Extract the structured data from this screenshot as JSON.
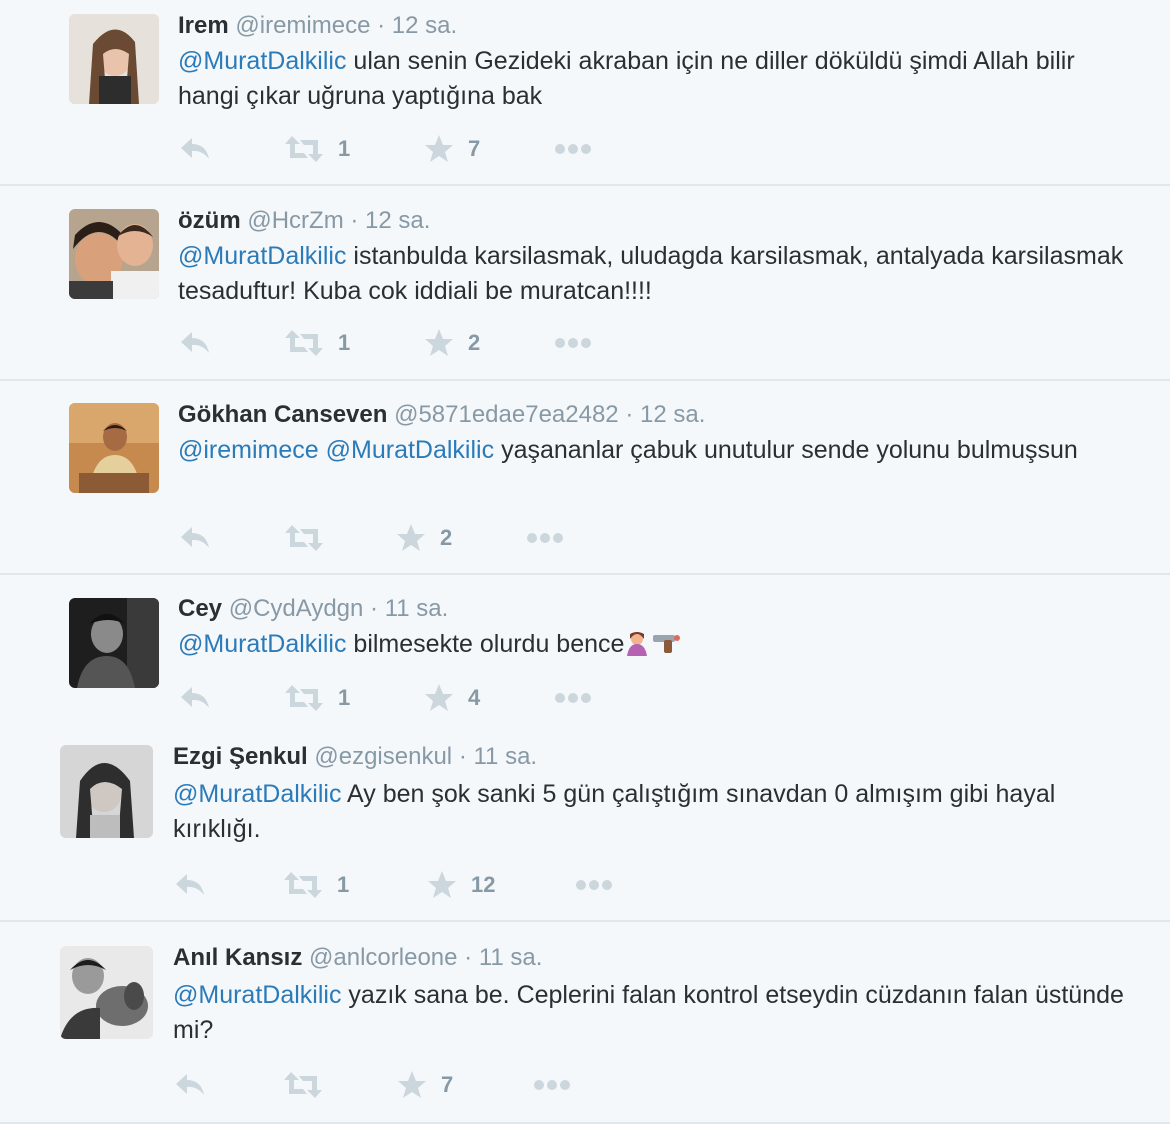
{
  "colors": {
    "mention": "#2b7bb9",
    "meta": "#8899a6",
    "text": "#292f33",
    "background": "#f5f8fa",
    "divider": "#e1e8ed"
  },
  "icons": {
    "reply": "reply-icon",
    "retweet": "retweet-icon",
    "favorite": "star-icon",
    "more": "more-icon"
  },
  "tweets": [
    {
      "name": "Irem",
      "handle": "@iremimece",
      "dot": "·",
      "time": "12 sa.",
      "mentions": [
        "@MuratDalkilic"
      ],
      "text": "ulan senin Gezideki akraban için ne diller döküldü şimdi Allah bilir hangi çıkar uğruna yaptığına bak",
      "retweets": "1",
      "favorites": "7"
    },
    {
      "name": "özüm",
      "handle": "@HcrZm",
      "dot": "·",
      "time": "12 sa.",
      "mentions": [
        "@MuratDalkilic"
      ],
      "text": "istanbulda karsilasmak, uludagda karsilasmak, antalyada karsilasmak tesaduftur! Kuba cok iddiali be muratcan!!!!",
      "retweets": "1",
      "favorites": "2"
    },
    {
      "name": "Gökhan Canseven",
      "handle": "@5871edae7ea2482",
      "dot": "·",
      "time": "12 sa.",
      "mentions": [
        "@iremimece",
        "@MuratDalkilic"
      ],
      "text": "yaşananlar çabuk unutulur sende yolunu bulmuşsun",
      "retweets": "",
      "favorites": "2"
    },
    {
      "name": "Cey",
      "handle": "@CydAydgn",
      "dot": "·",
      "time": "11 sa.",
      "mentions": [
        "@MuratDalkilic"
      ],
      "text": "bilmesekte olurdu bence",
      "retweets": "1",
      "favorites": "4"
    },
    {
      "name": "Ezgi Şenkul",
      "handle": "@ezgisenkul",
      "dot": "·",
      "time": "11 sa.",
      "mentions": [
        "@MuratDalkilic"
      ],
      "text": "Ay ben şok sanki 5 gün çalıştığım sınavdan 0 almışım gibi hayal kırıklığı.",
      "retweets": "1",
      "favorites": "12"
    },
    {
      "name": "Anıl Kansız",
      "handle": "@anlcorleone",
      "dot": "·",
      "time": "11 sa.",
      "mentions": [
        "@MuratDalkilic"
      ],
      "text": "yazık sana be. Ceplerini falan kontrol etseydin cüzdanın falan üstünde mi?",
      "retweets": "",
      "favorites": "7"
    }
  ]
}
